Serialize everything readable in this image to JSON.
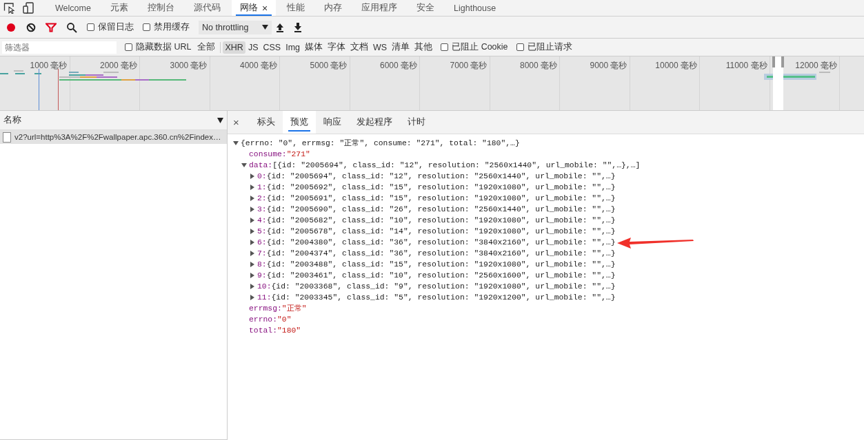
{
  "top_tabs": [
    {
      "label": "Welcome",
      "selected": false
    },
    {
      "label": "元素",
      "selected": false
    },
    {
      "label": "控制台",
      "selected": false
    },
    {
      "label": "源代码",
      "selected": false
    },
    {
      "label": "网络",
      "selected": true,
      "close": "×"
    },
    {
      "label": "性能",
      "selected": false
    },
    {
      "label": "内存",
      "selected": false
    },
    {
      "label": "应用程序",
      "selected": false
    },
    {
      "label": "安全",
      "selected": false
    },
    {
      "label": "Lighthouse",
      "selected": false
    }
  ],
  "toolbar": {
    "recording": true,
    "filter_on": true,
    "checkboxes": [
      {
        "label": "保留日志",
        "checked": false
      },
      {
        "label": "禁用缓存",
        "checked": false
      }
    ],
    "throttling": "No throttling"
  },
  "filter_bar": {
    "placeholder": "筛选器",
    "hide_data_url": {
      "label": "隐藏数据 URL",
      "checked": false
    },
    "types": [
      {
        "label": "全部",
        "selected": false
      },
      {
        "label": "XHR",
        "selected": true
      },
      {
        "label": "JS",
        "selected": false
      },
      {
        "label": "CSS",
        "selected": false
      },
      {
        "label": "Img",
        "selected": false
      },
      {
        "label": "媒体",
        "selected": false
      },
      {
        "label": "字体",
        "selected": false
      },
      {
        "label": "文档",
        "selected": false
      },
      {
        "label": "WS",
        "selected": false
      },
      {
        "label": "清单",
        "selected": false
      },
      {
        "label": "其他",
        "selected": false
      }
    ],
    "blocked": [
      {
        "label": "已阻止 Cookie",
        "checked": false
      },
      {
        "label": "已阻止请求",
        "checked": false
      }
    ]
  },
  "overview": {
    "ticks": [
      "1000 毫秒",
      "2000 毫秒",
      "3000 毫秒",
      "4000 毫秒",
      "5000 毫秒",
      "6000 毫秒",
      "7000 毫秒",
      "8000 毫秒",
      "9000 毫秒",
      "10000 毫秒",
      "11000 毫秒",
      "12000 毫秒"
    ]
  },
  "requests": {
    "column": "名称",
    "rows": [
      {
        "name": "v2?url=http%3A%2F%2Fwallpaper.apc.360.cn%2Findex…",
        "selected": true
      }
    ]
  },
  "detail": {
    "close": "×",
    "tabs": [
      {
        "label": "标头",
        "selected": false
      },
      {
        "label": "预览",
        "selected": true
      },
      {
        "label": "响应",
        "selected": false
      },
      {
        "label": "发起程序",
        "selected": false
      },
      {
        "label": "计时",
        "selected": false
      }
    ],
    "preview": [
      {
        "summary": "{errno: \"0\", errmsg: \"正常\", consume: \"271\", total: \"180\",…}",
        "expanded": true,
        "children": [
          {
            "key": "consume:",
            "value": "\"271\""
          },
          {
            "key": "data:",
            "summary": "[{id: \"2005694\", class_id: \"12\", resolution: \"2560x1440\", url_mobile: \"\",…},…]",
            "expanded": true,
            "children": [
              {
                "key": "0:",
                "summary": "{id: \"2005694\", class_id: \"12\", resolution: \"2560x1440\", url_mobile: \"\",…}",
                "expanded": false
              },
              {
                "key": "1:",
                "summary": "{id: \"2005692\", class_id: \"15\", resolution: \"1920x1080\", url_mobile: \"\",…}",
                "expanded": false
              },
              {
                "key": "2:",
                "summary": "{id: \"2005691\", class_id: \"15\", resolution: \"1920x1080\", url_mobile: \"\",…}",
                "expanded": false
              },
              {
                "key": "3:",
                "summary": "{id: \"2005690\", class_id: \"26\", resolution: \"2560x1440\", url_mobile: \"\",…}",
                "expanded": false
              },
              {
                "key": "4:",
                "summary": "{id: \"2005682\", class_id: \"10\", resolution: \"1920x1080\", url_mobile: \"\",…}",
                "expanded": false
              },
              {
                "key": "5:",
                "summary": "{id: \"2005678\", class_id: \"14\", resolution: \"1920x1080\", url_mobile: \"\",…}",
                "expanded": false
              },
              {
                "key": "6:",
                "summary": "{id: \"2004380\", class_id: \"36\", resolution: \"3840x2160\", url_mobile: \"\",…}",
                "expanded": false
              },
              {
                "key": "7:",
                "summary": "{id: \"2004374\", class_id: \"36\", resolution: \"3840x2160\", url_mobile: \"\",…}",
                "expanded": false
              },
              {
                "key": "8:",
                "summary": "{id: \"2003488\", class_id: \"15\", resolution: \"1920x1080\", url_mobile: \"\",…}",
                "expanded": false
              },
              {
                "key": "9:",
                "summary": "{id: \"2003461\", class_id: \"10\", resolution: \"2560x1600\", url_mobile: \"\",…}",
                "expanded": false
              },
              {
                "key": "10:",
                "summary": "{id: \"2003368\", class_id: \"9\", resolution: \"1920x1080\", url_mobile: \"\",…}",
                "expanded": false
              },
              {
                "key": "11:",
                "summary": "{id: \"2003345\", class_id: \"5\", resolution: \"1920x1200\", url_mobile: \"\",…}",
                "expanded": false
              }
            ]
          },
          {
            "key": "errmsg:",
            "value": "\"正常\""
          },
          {
            "key": "errno:",
            "value": "\"0\""
          },
          {
            "key": "total:",
            "value": "\"180\""
          }
        ]
      }
    ]
  }
}
